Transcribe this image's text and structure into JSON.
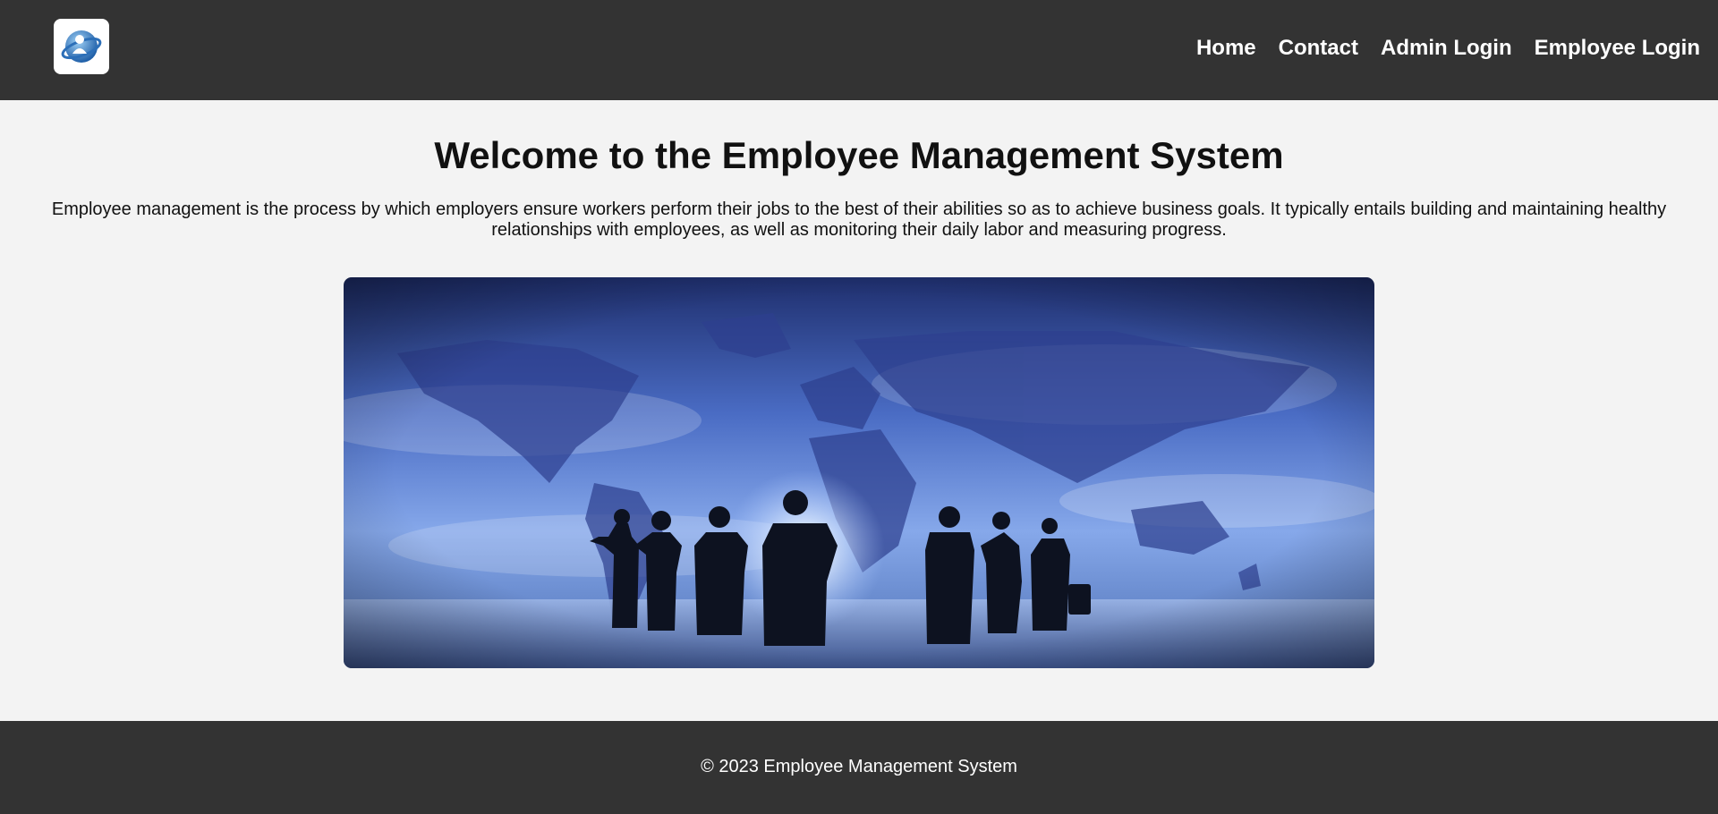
{
  "header": {
    "logo_icon": "employee-globe-logo-icon",
    "nav": [
      {
        "label": "Home"
      },
      {
        "label": "Contact"
      },
      {
        "label": "Admin Login"
      },
      {
        "label": "Employee Login"
      }
    ]
  },
  "main": {
    "title": "Welcome to the Employee Management System",
    "description": "Employee management is the process by which employers ensure workers perform their jobs to the best of their abilities so as to achieve business goals. It typically entails building and maintaining healthy relationships with employees, as well as monitoring their daily labor and measuring progress.",
    "hero_image": "business-team-world-map-image"
  },
  "footer": {
    "text": "© 2023 Employee Management System"
  },
  "colors": {
    "header_bg": "#333333",
    "page_bg": "#f3f3f3",
    "footer_bg": "#333333",
    "nav_text": "#ffffff"
  }
}
